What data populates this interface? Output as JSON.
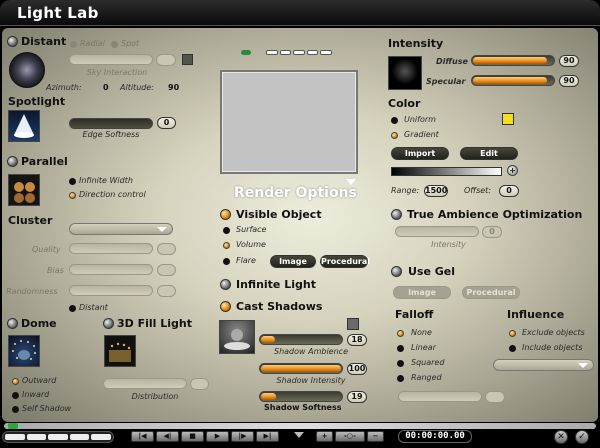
{
  "title": "Light Lab",
  "distant": {
    "label": "Distant",
    "radial": "Radial",
    "spot": "Spot",
    "sky": "Sky Interaction",
    "azimuth_label": "Azimuth:",
    "azimuth_val": "0",
    "altitude_label": "Altitude:",
    "altitude_val": "90"
  },
  "spotlight": {
    "label": "Spotlight",
    "edge_softness": "Edge Softness",
    "edge_val": "0"
  },
  "parallel": {
    "label": "Parallel",
    "infinite_width": "Infinite Width",
    "direction_control": "Direction control"
  },
  "cluster": {
    "label": "Cluster",
    "quality": "Quality",
    "bias": "Bias",
    "randomness": "Randomness",
    "distant": "Distant"
  },
  "dome": {
    "label": "Dome",
    "outward": "Outward",
    "inward": "Inward",
    "self_shadow": "Self Shadow"
  },
  "fill": {
    "label": "3D Fill Light",
    "distribution": "Distribution"
  },
  "render": {
    "title": "Render Options",
    "visible_object": "Visible Object",
    "surface": "Surface",
    "volume": "Volume",
    "flare": "Flare",
    "image_btn": "Image",
    "procedural_btn": "Procedural",
    "infinite_light": "Infinite Light",
    "cast_shadows": "Cast Shadows",
    "shadow_ambience": "Shadow Ambience",
    "shadow_ambience_val": "18",
    "shadow_intensity": "Shadow Intensity",
    "shadow_intensity_val": "100",
    "shadow_softness": "Shadow Softness",
    "shadow_softness_val": "19"
  },
  "intensity": {
    "label": "Intensity",
    "diffuse": "Diffuse",
    "diffuse_val": "90",
    "specular": "Specular",
    "specular_val": "90"
  },
  "color": {
    "label": "Color",
    "uniform": "Uniform",
    "gradient": "Gradient",
    "import_btn": "Import",
    "edit_btn": "Edit",
    "range_label": "Range:",
    "range_val": "1500",
    "offset_label": "Offset:",
    "offset_val": "0",
    "swatch": "#f2e020"
  },
  "tao": {
    "label": "True Ambience Optimization",
    "intensity": "Intensity",
    "intensity_val": "0"
  },
  "gel": {
    "label": "Use Gel",
    "image_btn": "Image",
    "procedural_btn": "Procedural"
  },
  "falloff": {
    "label": "Falloff",
    "none": "None",
    "linear": "Linear",
    "squared": "Squared",
    "ranged": "Ranged"
  },
  "influence": {
    "label": "Influence",
    "exclude": "Exclude objects",
    "include": "Include objects"
  },
  "transport": {
    "timecode": "00:00:00.00"
  },
  "colors": {
    "accent": "#e88a18",
    "panel": "#d6d3be"
  }
}
